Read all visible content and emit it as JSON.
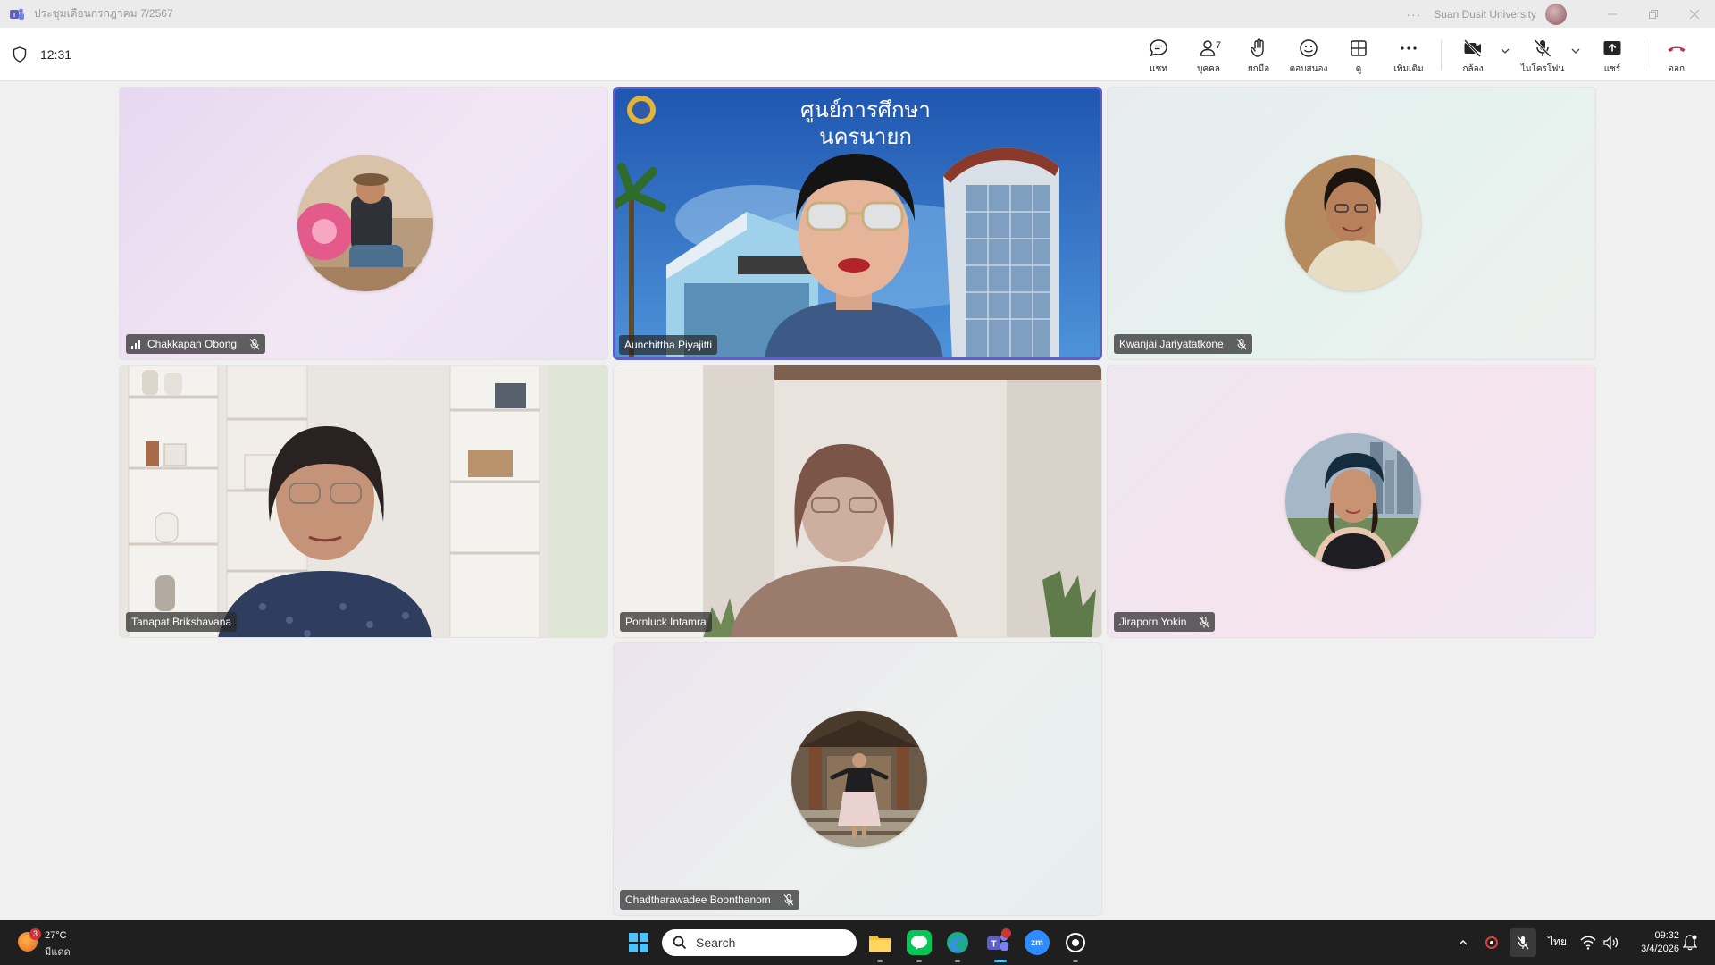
{
  "window": {
    "title": "ประชุมเดือนกรกฎาคม 7/2567",
    "org_name": "Suan Dusit University",
    "more_icon": "ellipsis-icon"
  },
  "meeting": {
    "timer": "12:31"
  },
  "toolbar": {
    "chat_label": "แชท",
    "people_label": "บุคคล",
    "people_count": "7",
    "raise_label": "ยกมือ",
    "react_label": "ตอบสนอง",
    "view_label": "ดู",
    "more_label": "เพิ่มเติม",
    "camera_label": "กล้อง",
    "mic_label": "ไมโครโฟน",
    "share_label": "แชร์",
    "leave_label": "ออก",
    "leave_color": "#c4314b",
    "accent_color": "#5b5fc7"
  },
  "participants": [
    {
      "name": "Chakkapan Obong",
      "type": "avatar",
      "muted": true,
      "signal_icon": true,
      "bg": "lavender"
    },
    {
      "name": "Aunchittha Piyajitti",
      "type": "video",
      "muted": false,
      "active_speaker": true,
      "video_caption": "ศูนย์การศึกษา นครนายก"
    },
    {
      "name": "Kwanjai Jariyatatkone",
      "type": "avatar",
      "muted": true,
      "bg": "mint"
    },
    {
      "name": "Tanapat Brikshavana",
      "type": "video",
      "muted": false
    },
    {
      "name": "Pornluck Intamra",
      "type": "video",
      "muted": false
    },
    {
      "name": "Jiraporn Yokin",
      "type": "avatar",
      "muted": true,
      "bg": "pink"
    },
    {
      "name": "Chadtharawadee Boonthanom",
      "type": "avatar",
      "muted": true,
      "bg": "lavender"
    }
  ],
  "taskbar": {
    "weather_temp": "27°C",
    "weather_cond": "มีแดด",
    "weather_badge": "3",
    "search_placeholder": "Search",
    "apps": [
      "file-explorer",
      "line",
      "edge",
      "teams",
      "zoom",
      "obs"
    ],
    "zoom_label": "zm",
    "tray_lang": "ไทย",
    "time": "09:32",
    "date": "3/4/2026"
  }
}
